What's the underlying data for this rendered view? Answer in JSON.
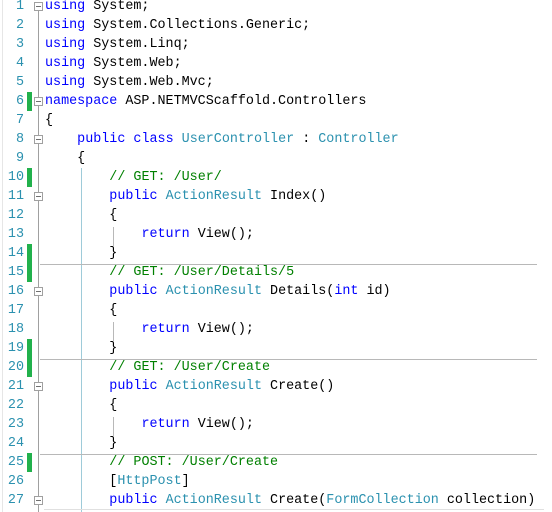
{
  "editor": {
    "language": "csharp",
    "lines": [
      {
        "num": "1",
        "changed": false,
        "fold": true,
        "tokens": [
          [
            "kw",
            "using"
          ],
          [
            "plain",
            " System;"
          ]
        ]
      },
      {
        "num": "2",
        "changed": false,
        "fold": false,
        "tokens": [
          [
            "kw",
            "using"
          ],
          [
            "plain",
            " System.Collections.Generic;"
          ]
        ]
      },
      {
        "num": "3",
        "changed": false,
        "fold": false,
        "tokens": [
          [
            "kw",
            "using"
          ],
          [
            "plain",
            " System.Linq;"
          ]
        ]
      },
      {
        "num": "4",
        "changed": false,
        "fold": false,
        "tokens": [
          [
            "kw",
            "using"
          ],
          [
            "plain",
            " System.Web;"
          ]
        ]
      },
      {
        "num": "5",
        "changed": false,
        "fold": false,
        "tokens": [
          [
            "kw",
            "using"
          ],
          [
            "plain",
            " System.Web.Mvc;"
          ]
        ]
      },
      {
        "num": "6",
        "changed": true,
        "fold": true,
        "tokens": [
          [
            "kw",
            "namespace"
          ],
          [
            "plain",
            " ASP.NETMVCScaffold.Controllers"
          ]
        ]
      },
      {
        "num": "7",
        "changed": false,
        "fold": false,
        "tokens": [
          [
            "plain",
            "{"
          ]
        ]
      },
      {
        "num": "8",
        "changed": false,
        "fold": true,
        "tokens": [
          [
            "plain",
            "    "
          ],
          [
            "kw",
            "public"
          ],
          [
            "plain",
            " "
          ],
          [
            "kw",
            "class"
          ],
          [
            "plain",
            " "
          ],
          [
            "type",
            "UserController"
          ],
          [
            "plain",
            " : "
          ],
          [
            "type",
            "Controller"
          ]
        ]
      },
      {
        "num": "9",
        "changed": false,
        "fold": false,
        "tokens": [
          [
            "plain",
            "    {"
          ]
        ]
      },
      {
        "num": "10",
        "changed": true,
        "fold": false,
        "tokens": [
          [
            "plain",
            "        "
          ],
          [
            "cm",
            "// GET: /User/"
          ]
        ]
      },
      {
        "num": "11",
        "changed": false,
        "fold": true,
        "tokens": [
          [
            "plain",
            "        "
          ],
          [
            "kw",
            "public"
          ],
          [
            "plain",
            " "
          ],
          [
            "type",
            "ActionResult"
          ],
          [
            "plain",
            " Index()"
          ]
        ]
      },
      {
        "num": "12",
        "changed": false,
        "fold": false,
        "tokens": [
          [
            "plain",
            "        {"
          ]
        ]
      },
      {
        "num": "13",
        "changed": false,
        "fold": false,
        "tokens": [
          [
            "plain",
            "            "
          ],
          [
            "kw",
            "return"
          ],
          [
            "plain",
            " View();"
          ]
        ]
      },
      {
        "num": "14",
        "changed": true,
        "fold": false,
        "tokens": [
          [
            "plain",
            "        }"
          ]
        ]
      },
      {
        "num": "15",
        "changed": true,
        "fold": false,
        "tokens": [
          [
            "plain",
            "        "
          ],
          [
            "cm",
            "// GET: /User/Details/5"
          ]
        ]
      },
      {
        "num": "16",
        "changed": false,
        "fold": true,
        "tokens": [
          [
            "plain",
            "        "
          ],
          [
            "kw",
            "public"
          ],
          [
            "plain",
            " "
          ],
          [
            "type",
            "ActionResult"
          ],
          [
            "plain",
            " Details("
          ],
          [
            "kw",
            "int"
          ],
          [
            "plain",
            " id)"
          ]
        ]
      },
      {
        "num": "17",
        "changed": false,
        "fold": false,
        "tokens": [
          [
            "plain",
            "        {"
          ]
        ]
      },
      {
        "num": "18",
        "changed": false,
        "fold": false,
        "tokens": [
          [
            "plain",
            "            "
          ],
          [
            "kw",
            "return"
          ],
          [
            "plain",
            " View();"
          ]
        ]
      },
      {
        "num": "19",
        "changed": true,
        "fold": false,
        "tokens": [
          [
            "plain",
            "        }"
          ]
        ]
      },
      {
        "num": "20",
        "changed": true,
        "fold": false,
        "tokens": [
          [
            "plain",
            "        "
          ],
          [
            "cm",
            "// GET: /User/Create"
          ]
        ]
      },
      {
        "num": "21",
        "changed": false,
        "fold": true,
        "tokens": [
          [
            "plain",
            "        "
          ],
          [
            "kw",
            "public"
          ],
          [
            "plain",
            " "
          ],
          [
            "type",
            "ActionResult"
          ],
          [
            "plain",
            " Create()"
          ]
        ]
      },
      {
        "num": "22",
        "changed": false,
        "fold": false,
        "tokens": [
          [
            "plain",
            "        {"
          ]
        ]
      },
      {
        "num": "23",
        "changed": false,
        "fold": false,
        "tokens": [
          [
            "plain",
            "            "
          ],
          [
            "kw",
            "return"
          ],
          [
            "plain",
            " View();"
          ]
        ]
      },
      {
        "num": "24",
        "changed": false,
        "fold": false,
        "tokens": [
          [
            "plain",
            "        }"
          ]
        ]
      },
      {
        "num": "25",
        "changed": true,
        "fold": false,
        "tokens": [
          [
            "plain",
            "        "
          ],
          [
            "cm",
            "// POST: /User/Create"
          ]
        ]
      },
      {
        "num": "26",
        "changed": false,
        "fold": false,
        "tokens": [
          [
            "plain",
            "        ["
          ],
          [
            "type",
            "HttpPost"
          ],
          [
            "plain",
            "]"
          ]
        ]
      },
      {
        "num": "27",
        "changed": false,
        "fold": true,
        "tokens": [
          [
            "plain",
            "        "
          ],
          [
            "kw",
            "public"
          ],
          [
            "plain",
            " "
          ],
          [
            "type",
            "ActionResult"
          ],
          [
            "plain",
            " Create("
          ],
          [
            "type",
            "FormCollection"
          ],
          [
            "plain",
            " collection)"
          ]
        ]
      }
    ],
    "method_separators_after_lines": [
      14,
      19,
      24
    ],
    "colors": {
      "keyword": "#0000ff",
      "type": "#2b91af",
      "comment": "#008000",
      "line_number": "#2b91af",
      "change_marker": "#22b14c"
    }
  }
}
